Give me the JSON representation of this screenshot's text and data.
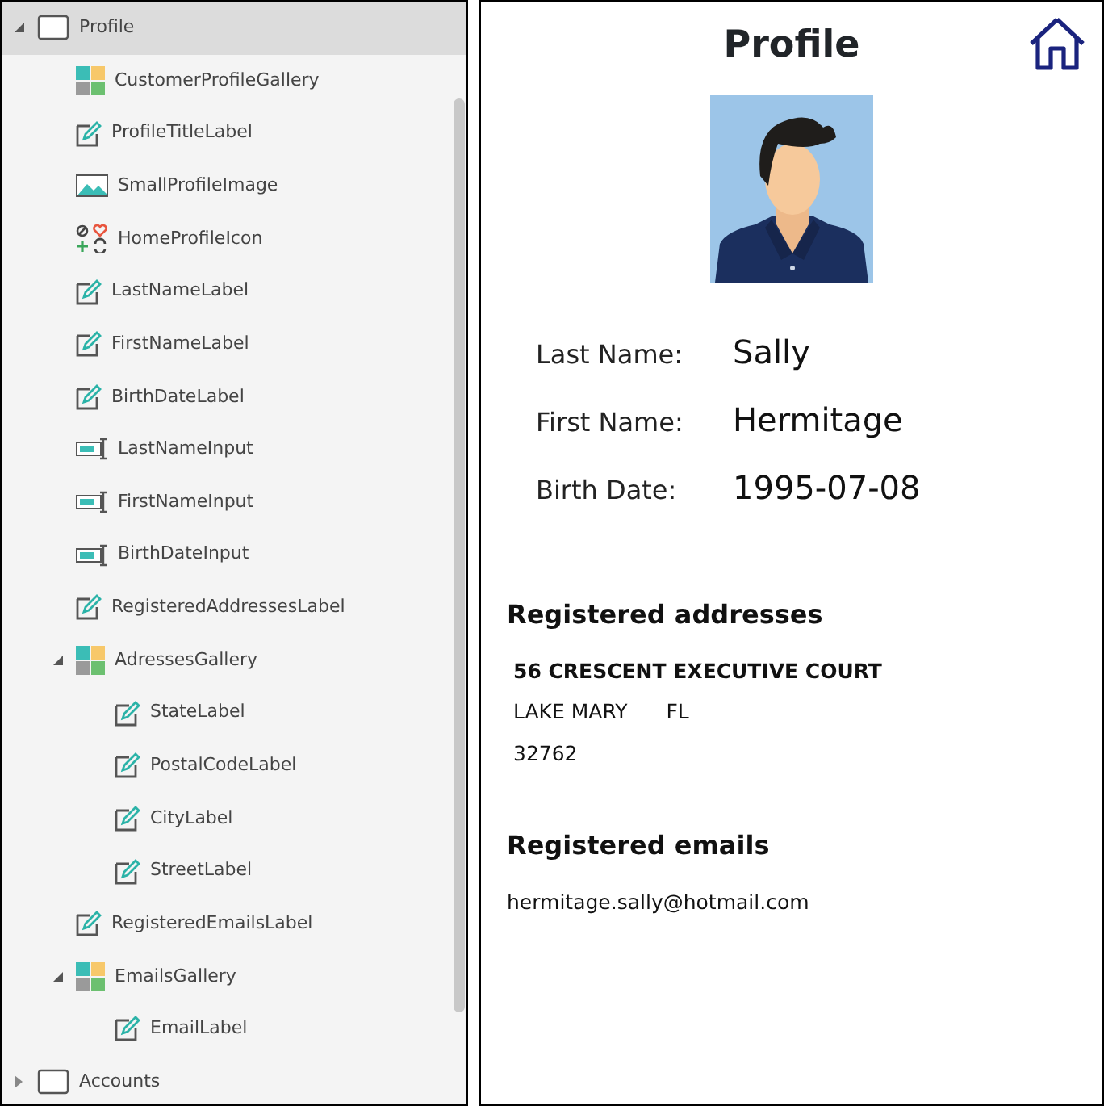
{
  "tree": [
    {
      "label": "Profile",
      "kind": "screen",
      "expanded": true,
      "selected": true,
      "children": [
        {
          "label": "CustomerProfileGallery",
          "kind": "gallery",
          "selected": false
        },
        {
          "label": "ProfileTitleLabel",
          "kind": "label",
          "selected": false
        },
        {
          "label": "SmallProfileImage",
          "selected": false
        },
        {
          "label": "HomeProfileIcon",
          "kind": "icon",
          "selected": false
        },
        {
          "label": "LastNameLabel",
          "kind": "label",
          "selected": false
        },
        {
          "label": "FirstNameLabel",
          "kind": "label",
          "selected": false
        },
        {
          "label": "BirthDateLabel",
          "kind": "label",
          "selected": false
        },
        {
          "label": "LastNameInput",
          "kind": "input",
          "selected": false
        },
        {
          "label": "FirstNameInput",
          "kind": "input",
          "selected": false
        },
        {
          "label": "BirthDateInput",
          "kind": "input",
          "selected": false
        },
        {
          "label": "RegisteredAddressesLabel",
          "kind": "label",
          "selected": false
        },
        {
          "label": "AdressesGallery",
          "kind": "gallery",
          "expanded": true,
          "selected": false,
          "children": [
            {
              "label": "StateLabel",
              "kind": "label",
              "selected": false
            },
            {
              "label": "PostalCodeLabel",
              "kind": "label",
              "selected": false
            },
            {
              "label": "CityLabel",
              "kind": "label",
              "selected": false
            },
            {
              "label": "StreetLabel",
              "kind": "label",
              "selected": false
            }
          ]
        },
        {
          "label": "RegisteredEmailsLabel",
          "kind": "label",
          "selected": false
        },
        {
          "label": "EmailsGallery",
          "kind": "gallery",
          "expanded": true,
          "selected": false,
          "children": [
            {
              "label": "EmailLabel",
              "kind": "label",
              "selected": false
            }
          ]
        }
      ]
    },
    {
      "label": "Accounts",
      "kind": "screen",
      "expanded": false,
      "selected": false
    }
  ],
  "preview": {
    "title": "Profile",
    "fields": [
      {
        "label": "Last Name:",
        "value": "Sally"
      },
      {
        "label": "First Name:",
        "value": "Hermitage"
      },
      {
        "label": "Birth Date:",
        "value": "1995-07-08"
      }
    ],
    "addresses_heading": "Registered addresses",
    "addresses": [
      {
        "street": "56 CRESCENT EXECUTIVE COURT",
        "city": "LAKE MARY",
        "state": "FL",
        "postal_code": "32762"
      }
    ],
    "emails_heading": "Registered emails",
    "emails": [
      {
        "email": "hermitage.sally@hotmail.com"
      }
    ]
  }
}
